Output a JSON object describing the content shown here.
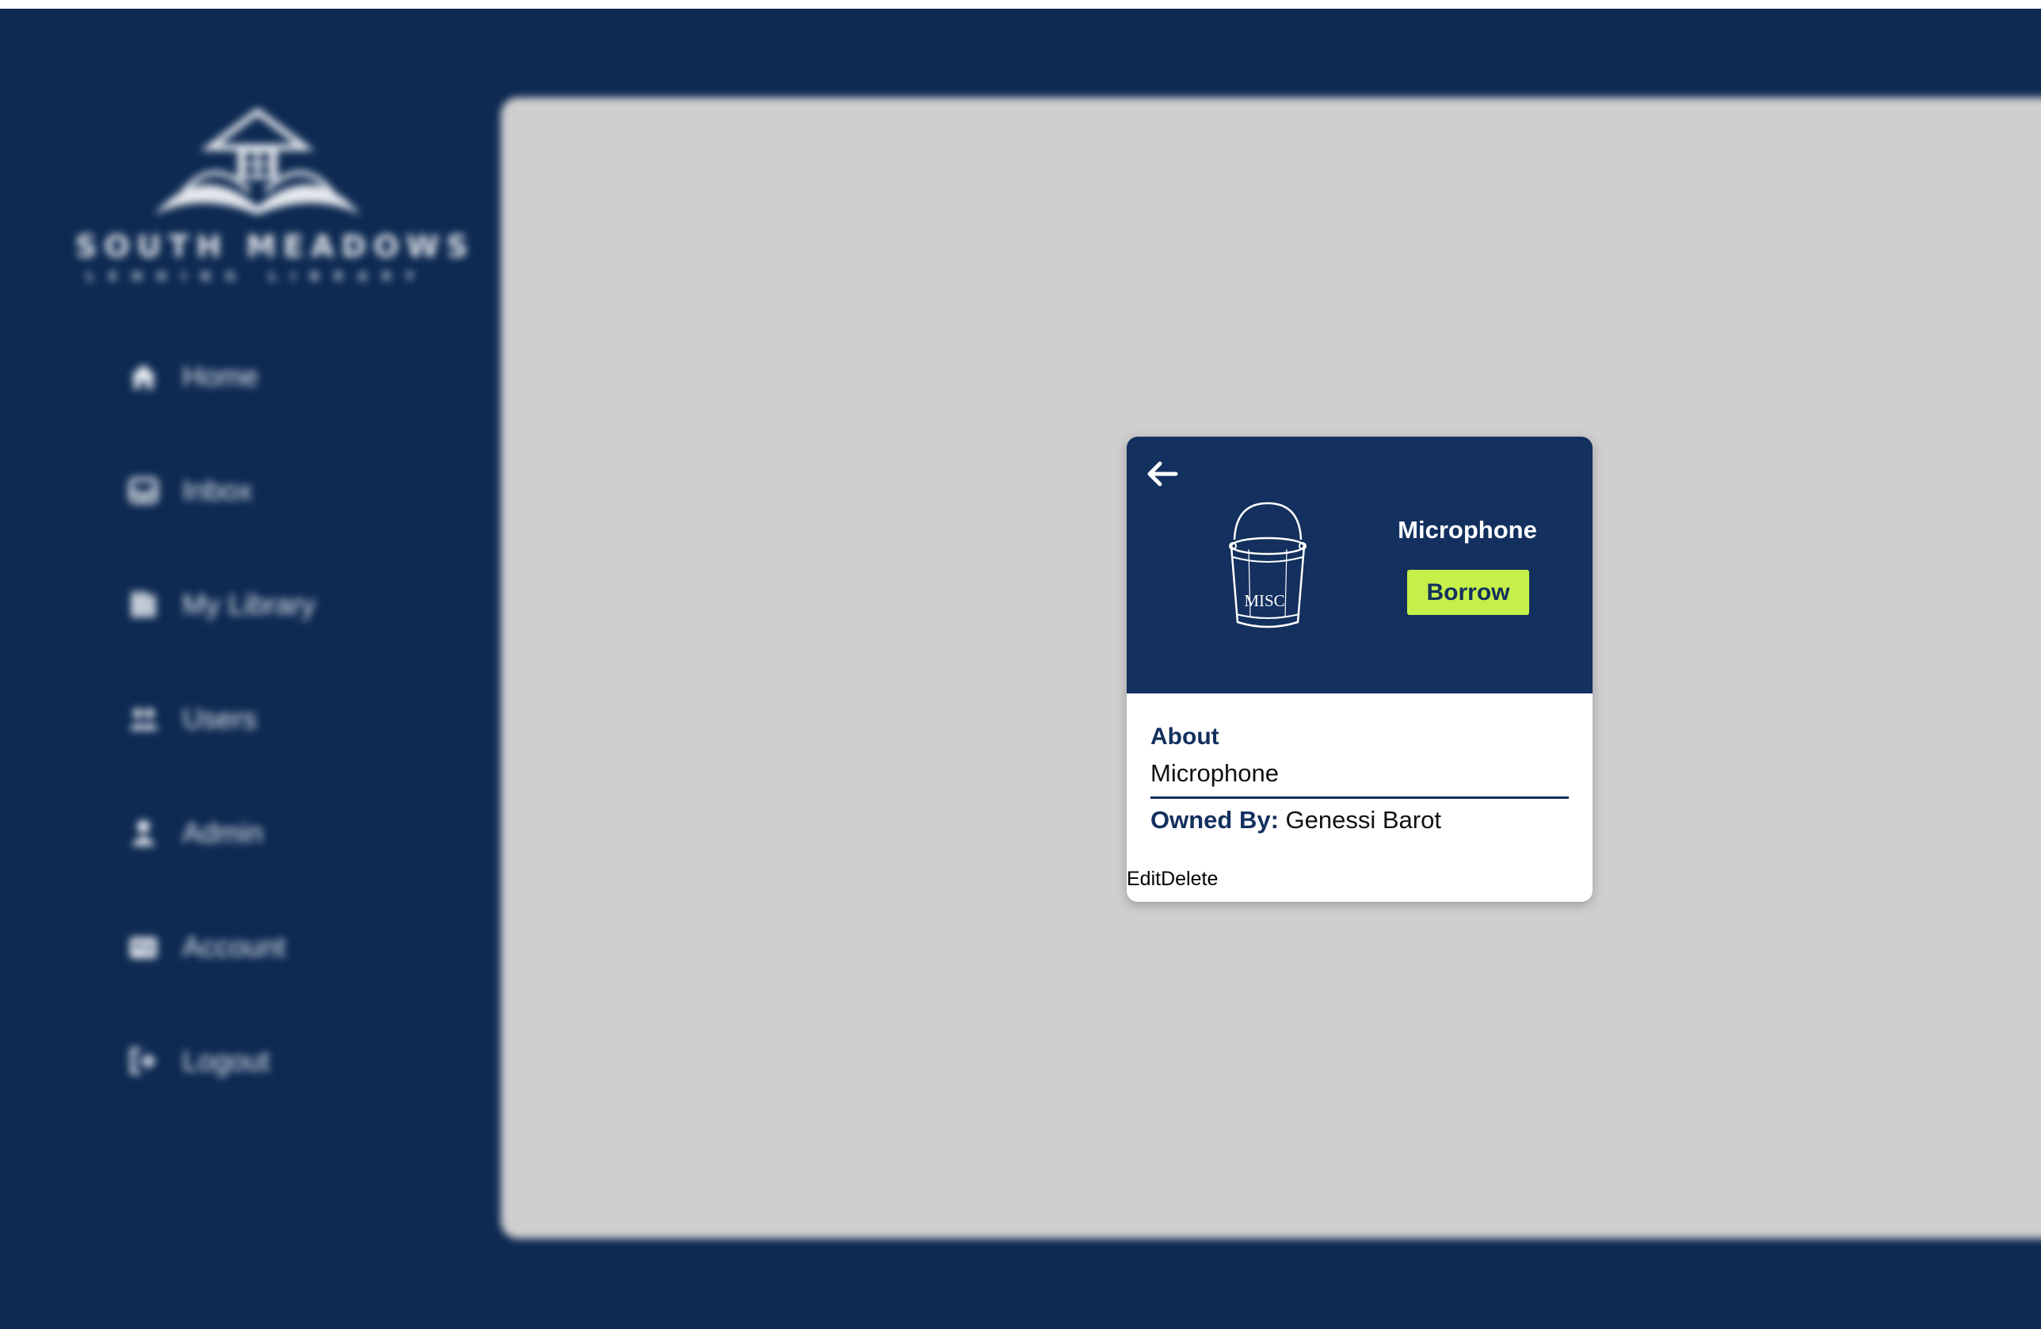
{
  "brand": {
    "name": "SOUTH MEADOWS",
    "tagline": "LENDING LIBRARY"
  },
  "sidebar": {
    "items": [
      {
        "label": "Home",
        "icon": "home-icon"
      },
      {
        "label": "Inbox",
        "icon": "inbox-icon"
      },
      {
        "label": "My Library",
        "icon": "library-icon"
      },
      {
        "label": "Users",
        "icon": "users-icon"
      },
      {
        "label": "Admin",
        "icon": "admin-icon"
      },
      {
        "label": "Account",
        "icon": "account-card-icon"
      },
      {
        "label": "Logout",
        "icon": "logout-icon"
      }
    ]
  },
  "item_card": {
    "title": "Microphone",
    "borrow_label": "Borrow",
    "image_label": "MISC",
    "about_label": "About",
    "about_value": "Microphone",
    "owned_by_label": "Owned By:",
    "owner_name": "Genessi Barot",
    "edit_label": "Edit",
    "delete_label": "Delete"
  },
  "colors": {
    "navy": "#0e2a52",
    "card_header": "#13305e",
    "accent": "#c5f04a",
    "panel": "#cfcfcf"
  }
}
